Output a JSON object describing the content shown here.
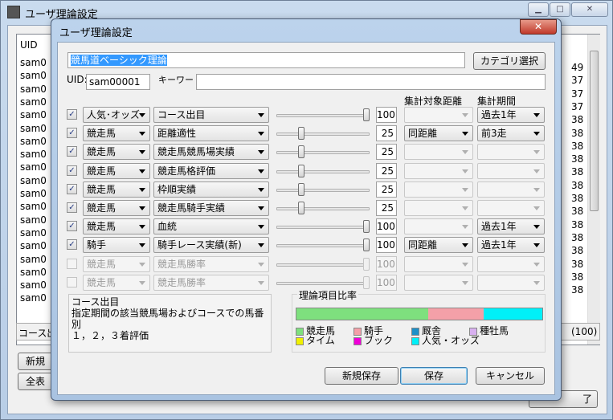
{
  "background_window": {
    "title": "ユーザ理論設定",
    "uid_header": "UID",
    "list_items": [
      "sam0",
      "sam0",
      "sam0",
      "sam0",
      "sam0",
      "sam0",
      "sam0",
      "sam0",
      "sam0",
      "sam0",
      "sam0",
      "sam0",
      "sam0",
      "sam0",
      "sam0",
      "sam0",
      "sam0",
      "sam0",
      "sam0"
    ],
    "right_nums": [
      "49",
      "37",
      "37",
      "37",
      "38",
      "38",
      "38",
      "38",
      "38",
      "38",
      "38",
      "38",
      "38",
      "38",
      "38",
      "38",
      "38",
      "38"
    ],
    "bottom_left": "コース出目",
    "bottom_right": "(100)",
    "btn_new": "新規",
    "btn_all": "全表",
    "btn_end": "了"
  },
  "dialog": {
    "title": "ユーザ理論設定",
    "name_value": "競馬道ベーシック理論",
    "category_btn": "カテゴリ選択",
    "uid_label": "UID:",
    "uid_value": "sam00001",
    "keyword_label": "キーワード:",
    "keyword_value": "",
    "col_distance": "集計対象距離",
    "col_period": "集計期間",
    "rows": [
      {
        "checked": "✓",
        "enabled": true,
        "cat": "人気･オッズ",
        "item": "コース出目",
        "value": "100",
        "slider": 1.0,
        "dist": "",
        "dist_enabled": false,
        "period": "過去1年",
        "period_enabled": true
      },
      {
        "checked": "✓",
        "enabled": true,
        "cat": "競走馬",
        "item": "距離適性",
        "value": "25",
        "slider": 0.25,
        "dist": "同距離",
        "dist_enabled": true,
        "period": "前3走",
        "period_enabled": true
      },
      {
        "checked": "✓",
        "enabled": true,
        "cat": "競走馬",
        "item": "競走馬競馬場実績",
        "value": "25",
        "slider": 0.25,
        "dist": "",
        "dist_enabled": false,
        "period": "",
        "period_enabled": false
      },
      {
        "checked": "✓",
        "enabled": true,
        "cat": "競走馬",
        "item": "競走馬格評価",
        "value": "25",
        "slider": 0.25,
        "dist": "",
        "dist_enabled": false,
        "period": "",
        "period_enabled": false
      },
      {
        "checked": "✓",
        "enabled": true,
        "cat": "競走馬",
        "item": "枠順実績",
        "value": "25",
        "slider": 0.25,
        "dist": "",
        "dist_enabled": false,
        "period": "",
        "period_enabled": false
      },
      {
        "checked": "✓",
        "enabled": true,
        "cat": "競走馬",
        "item": "競走馬騎手実績",
        "value": "25",
        "slider": 0.25,
        "dist": "",
        "dist_enabled": false,
        "period": "",
        "period_enabled": false
      },
      {
        "checked": "✓",
        "enabled": true,
        "cat": "競走馬",
        "item": "血統",
        "value": "100",
        "slider": 1.0,
        "dist": "",
        "dist_enabled": false,
        "period": "過去1年",
        "period_enabled": true
      },
      {
        "checked": "✓",
        "enabled": true,
        "cat": "騎手",
        "item": "騎手レース実績(新)",
        "value": "100",
        "slider": 1.0,
        "dist": "同距離",
        "dist_enabled": true,
        "period": "過去1年",
        "period_enabled": true
      },
      {
        "checked": "",
        "enabled": false,
        "cat": "競走馬",
        "item": "競走馬勝率",
        "value": "100",
        "slider": 1.0,
        "dist": "",
        "dist_enabled": false,
        "period": "",
        "period_enabled": false
      },
      {
        "checked": "",
        "enabled": false,
        "cat": "競走馬",
        "item": "競走馬勝率",
        "value": "100",
        "slider": 1.0,
        "dist": "",
        "dist_enabled": false,
        "period": "",
        "period_enabled": false
      }
    ],
    "desc_title": "コース出目",
    "desc_line1": "指定期間の該当競馬場およびコースでの馬番別",
    "desc_line2": "１，２，３着評価",
    "ratio_title": "理論項目比率",
    "ratio_segments": [
      {
        "name": "競走馬",
        "fraction": 0.535,
        "color": "#7ee07e"
      },
      {
        "name": "騎手",
        "fraction": 0.227,
        "color": "#f4a0a8"
      },
      {
        "name": "人気・オッズ",
        "fraction": 0.238,
        "color": "#00f0f8"
      }
    ],
    "legend": [
      {
        "name": "競走馬",
        "color": "#7ee07e"
      },
      {
        "name": "騎手",
        "color": "#f4a0a8"
      },
      {
        "name": "厩舎",
        "color": "#1e90c8"
      },
      {
        "name": "種牡馬",
        "color": "#d8b0f0"
      },
      {
        "name": "タイム",
        "color": "#f0f000"
      },
      {
        "name": "ブック",
        "color": "#f000d8"
      },
      {
        "name": "人気・オッズ",
        "color": "#00f0f8"
      }
    ],
    "btn_new_save": "新規保存",
    "btn_save": "保存",
    "btn_cancel": "キャンセル"
  }
}
